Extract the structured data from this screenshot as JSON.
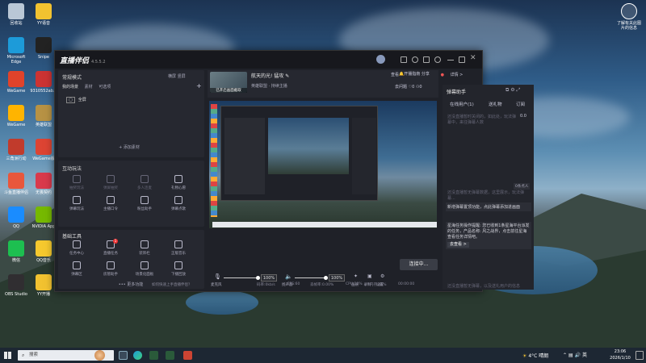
{
  "desktop": {
    "left_icons": [
      {
        "label": "回收站",
        "color": "#b9c7d6"
      },
      {
        "label": "YY语音",
        "color": "#f2c230"
      },
      {
        "label": "Microsoft Edge",
        "color": "#1d9bd9"
      },
      {
        "label": "Snipe",
        "color": "#222"
      },
      {
        "label": "WeGame",
        "color": "#e0432b"
      },
      {
        "label": "9310552ab...",
        "color": "#c33"
      },
      {
        "label": "WeGame",
        "color": "#ffb400"
      },
      {
        "label": "英雄联盟",
        "color": "#b79244"
      },
      {
        "label": "三角洲行动",
        "color": "#c13b2c"
      },
      {
        "label": "WeGame版",
        "color": "#d43"
      },
      {
        "label": "斗鱼直播伴侣",
        "color": "#e8573c"
      },
      {
        "label": "无畏契约",
        "color": "#d93a4c"
      },
      {
        "label": "QQ",
        "color": "#1a8cff"
      },
      {
        "label": "NVIDIA App",
        "color": "#76b900"
      },
      {
        "label": "微信",
        "color": "#1dbf50"
      },
      {
        "label": "QQ音乐",
        "color": "#f6c92e"
      },
      {
        "label": "OBS Studio",
        "color": "#302e31"
      },
      {
        "label": "YY开播",
        "color": "#f2c230"
      }
    ],
    "right_icon": {
      "label": "了解有关此图片的信息"
    }
  },
  "app": {
    "name": "直播伴侣",
    "version": "4.5.5.2",
    "window_controls": [
      "menu-icon",
      "headset-icon",
      "shirt-icon",
      "settings-icon",
      "minimize-icon",
      "restore-icon",
      "close-icon"
    ],
    "stream_title": "航天的光! 猛攻",
    "stream_cover_label": "已开启画面截取",
    "category": "英雄联盟 · 持续主播",
    "right_header": {
      "live_open_label": "开播指南",
      "share_label": "分享"
    },
    "left": {
      "mode_label": "常规模式",
      "mode_actions": [
        "横屏",
        "竖屏"
      ],
      "scene_tabs": [
        "我的场景",
        "素材",
        "可选项"
      ],
      "scene_item": "全屏",
      "add_source": "+ 添加素材",
      "interactive_title": "互动玩法",
      "interactive_tools": [
        {
          "label": "抽奖玩法",
          "icon": "gift-icon",
          "dim": true
        },
        {
          "label": "弹屏抽奖",
          "icon": "shield-icon",
          "dim": true
        },
        {
          "label": "多人连麦",
          "icon": "mic-group-icon",
          "dim": true
        },
        {
          "label": "礼物心愿",
          "icon": "gift-box-icon",
          "dim": false
        },
        {
          "label": "弹幕玩法",
          "icon": "download-icon",
          "dim": false
        },
        {
          "label": "主播口令",
          "icon": "chat-icon",
          "dim": false
        },
        {
          "label": "粉丝助手",
          "icon": "heart-icon",
          "dim": false
        },
        {
          "label": "弹幕点歌",
          "icon": "music-icon",
          "dim": false
        }
      ],
      "tools_title": "基础工具",
      "basic_tools": [
        {
          "label": "任务中心",
          "icon": "task-icon"
        },
        {
          "label": "直播任务",
          "icon": "task-list-icon",
          "badge": "1"
        },
        {
          "label": "装饰栏",
          "icon": "layers-icon"
        },
        {
          "label": "正版音乐",
          "icon": "music-note-icon"
        },
        {
          "label": "弹幕区",
          "icon": "comment-icon"
        },
        {
          "label": "房管助手",
          "icon": "lock-icon"
        },
        {
          "label": "场景化面板",
          "icon": "panel-icon"
        },
        {
          "label": "下播回放",
          "icon": "replay-icon"
        }
      ],
      "more_label": "••• 更多功能"
    },
    "center": {
      "toolbar": [
        "去问题",
        "0",
        "0"
      ],
      "mic_label": "麦克风",
      "mic_pct": "100%",
      "speaker_label": "扬声器",
      "speaker_pct": "100%",
      "extra_tools": [
        "画质",
        "录制",
        "设置"
      ],
      "live_button": "连接中...",
      "status_help": "如何快速上手直播伴侣？",
      "status_stats": [
        "码率:0kb/s",
        "FPS:60",
        "丢帧率:0.00%",
        "CPU:10%",
        "内存:46%",
        "00:00:00"
      ]
    },
    "right": {
      "title": "弹幕助手",
      "tabs": [
        "在线用户(1)",
        "送礼物",
        "订阅"
      ],
      "tab_value": "0.0",
      "placeholder_top": "还没直播暂时关闭的，如此处，玩法弹幕中，来往弹幕人数",
      "placeholder_mid": "还没直播暂无弹幕数据，这里展示，玩法弹幕...",
      "mid_badge": "0条点人",
      "notice_1": "新增弹幕置顶功能，点此弹幕添加进画面",
      "notice_2": "星海任务操作提醒: 您已收到1条星海平台派发的任务，产品名称: 风之战界，点击前往星海查看任务详情吧。",
      "notice_link": "去查看 >",
      "bottom_hint": "还没直播暂无弹幕，以及送礼用户的信息",
      "summary": "查看",
      "details": "详情 >"
    }
  },
  "taskbar": {
    "search_placeholder": "搜索",
    "weather": "4°C 晴朗",
    "time": "23:06",
    "date": "2026/1/10",
    "lang": "英",
    "pinned_icons": [
      "start-icon",
      "search-icon",
      "weather-icon",
      "task-view-icon",
      "edge-icon",
      "explorer-icon",
      "app-icon",
      "app-icon",
      "app-icon"
    ]
  }
}
